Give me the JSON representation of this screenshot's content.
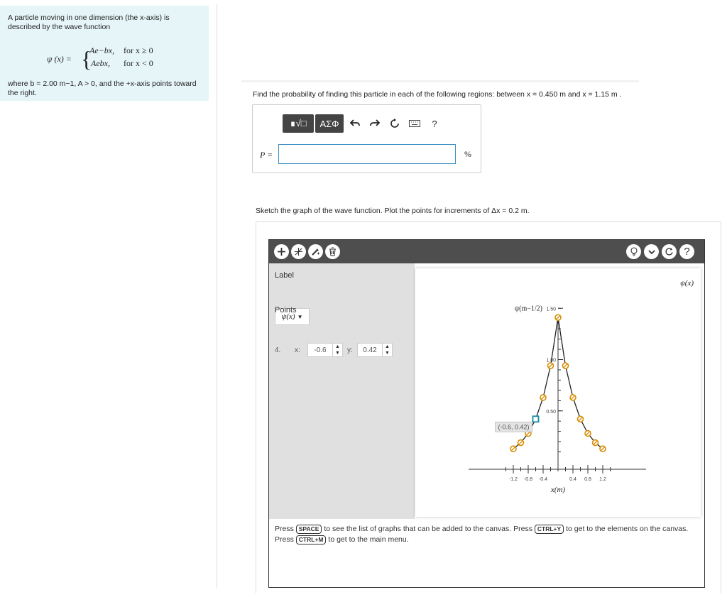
{
  "problem": {
    "intro": "A particle moving in one dimension (the x-axis) is described by the wave function",
    "lhs": "ψ (x) =",
    "case1_expr": "Ae−bx,",
    "case1_cond": "for x ≥ 0",
    "case2_expr": "Aebx,",
    "case2_cond": "for x < 0",
    "where": "where b = 2.00 m−1, A > 0, and the +x-axis points toward the right."
  },
  "question": {
    "text": "Find the probability of finding this particle in each of the following regions: between x = 0.450 m and x = 1.15 m ."
  },
  "answer": {
    "toolbar": {
      "templates": "∎√□",
      "symbols": "ΑΣΦ",
      "help": "?"
    },
    "label": "P =",
    "value": "",
    "unit": "%"
  },
  "sketch": {
    "instruction": "Sketch the graph of the wave function. Plot the points for increments of Δx = 0.2 m.",
    "panel": {
      "label_heading": "Label",
      "label_value": "ψ(x)",
      "points_heading": "Points",
      "point_index": "4.",
      "x_label": "x:",
      "x_value": "-0.6",
      "y_label": "y:",
      "y_value": "0.42"
    },
    "help_text": {
      "part1": "Press",
      "key1": "SPACE",
      "part2": "to see the list of graphs that can be added to the canvas. Press",
      "key2": "CTRL+Y",
      "part3": "to get to the elements on the canvas. Press",
      "key3": "CTRL+M",
      "part4": "to get to the main menu."
    }
  },
  "chart_data": {
    "type": "scatter",
    "title": "",
    "legend_label": "ψ(x)",
    "xlabel": "x(m)",
    "ylabel": "ψ(m−1/2)",
    "xlim": [
      -1.4,
      1.4
    ],
    "ylim": [
      -0.2,
      1.6
    ],
    "x_ticks": [
      "-1.2",
      "-0.8",
      "-0.4",
      "0.4",
      "0.8",
      "1.2"
    ],
    "y_ticks": [
      "0.50",
      "1.00",
      "1.50"
    ],
    "x": [
      -1.2,
      -1.0,
      -0.8,
      -0.6,
      -0.4,
      -0.2,
      0.0,
      0.2,
      0.4,
      0.6,
      0.8,
      1.0,
      1.2
    ],
    "y": [
      0.13,
      0.19,
      0.28,
      0.42,
      0.63,
      0.94,
      1.41,
      0.94,
      0.63,
      0.42,
      0.28,
      0.19,
      0.13
    ],
    "selected_point": {
      "x": -0.6,
      "y": 0.42,
      "label": "(-0.6, 0.42)"
    },
    "colors": {
      "points": "#d98c00",
      "line": "#222222",
      "selected": "#1a8ca0"
    }
  }
}
